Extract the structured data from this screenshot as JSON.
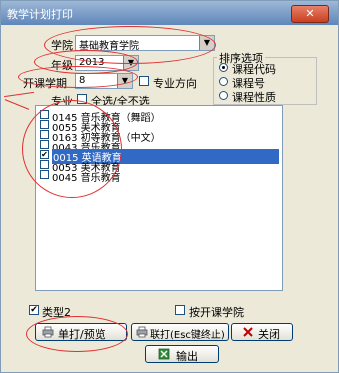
{
  "window": {
    "title": "教学计划打印",
    "close_glyph": "✕"
  },
  "form": {
    "college_label": "学院",
    "college_value": "基础教育学院",
    "grade_label": "年级",
    "grade_value": "2013",
    "term_label": "开课学期",
    "term_value": "8",
    "major_direction_label": "专业方向",
    "major_label": "专业",
    "select_all_label": "全选/全不选"
  },
  "sort": {
    "title": "排序选项",
    "options": [
      "课程代码",
      "课程号",
      "课程性质"
    ],
    "selected_index": 0
  },
  "list": {
    "items": [
      {
        "code": "0145",
        "name": "音乐教育（舞蹈）",
        "text": "0145 音乐教育（舞蹈）",
        "checked": false,
        "selected": false
      },
      {
        "code": "0055",
        "name": "美术教育",
        "text": "0055 美术教育",
        "checked": false,
        "selected": false
      },
      {
        "code": "0163",
        "name": "初等教育（中文）",
        "text": "0163 初等教育（中文）",
        "checked": false,
        "selected": false
      },
      {
        "code": "0043",
        "name": "音乐教育",
        "text": "0043 音乐教育",
        "checked": false,
        "selected": false
      },
      {
        "code": "0015",
        "name": "英语教育",
        "text": "0015 英语教育",
        "checked": true,
        "selected": true
      },
      {
        "code": "0053",
        "name": "美术教育",
        "text": "0053 美术教育",
        "checked": false,
        "selected": false
      },
      {
        "code": "0045",
        "name": "音乐教育",
        "text": "0045 音乐教育",
        "checked": false,
        "selected": false
      }
    ]
  },
  "options": {
    "type2_label": "类型2",
    "type2_checked": true,
    "by_term_college_label": "按开课学院",
    "by_term_college_checked": false
  },
  "buttons": {
    "print_preview": "单打/预览",
    "batch_print": "联打(Esc键终止)",
    "close": "关闭",
    "export": "输出"
  },
  "colors": {
    "title_bar": "#5f86ba",
    "selection": "#316ac5",
    "annotation": "#e03030",
    "dialog_bg": "#ece9d8"
  }
}
